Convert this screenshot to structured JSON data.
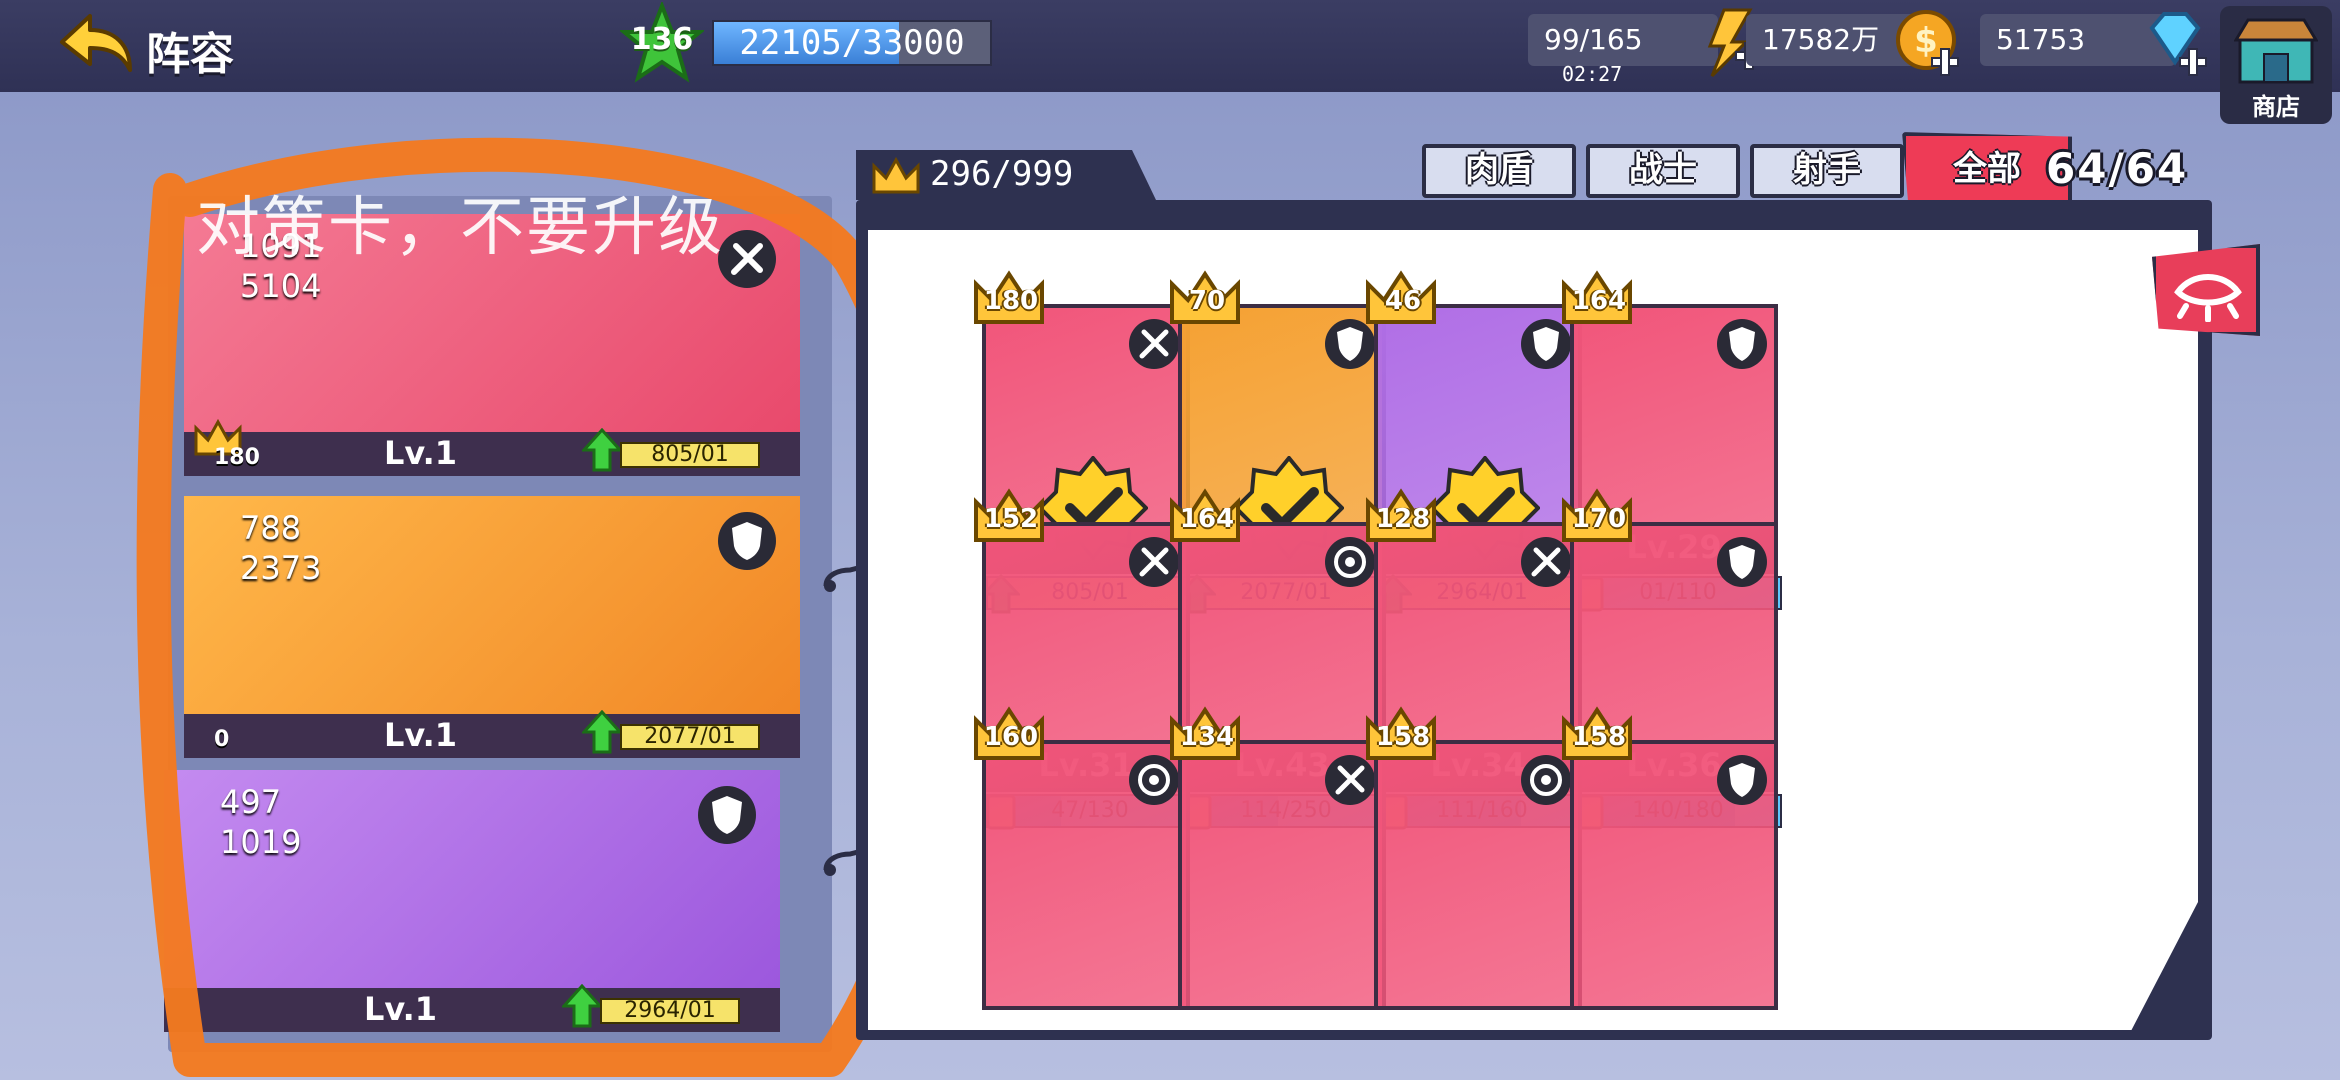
{
  "header": {
    "title": "阵容",
    "player_level": "136",
    "xp_text": "22105/33000",
    "xp_progress": 0.67,
    "stamina": "99/165",
    "stamina_timer": "02:27",
    "gold": "17582万",
    "gems": "51753",
    "shop_label": "商店"
  },
  "note": "对策卡，不要升级",
  "crown_count": "296/999",
  "filters": {
    "tabs": [
      "肉盾",
      "战士",
      "射手",
      "全部"
    ],
    "active": "全部",
    "count": "64/64"
  },
  "teams": [
    {
      "stats": [
        "1091",
        "5104"
      ],
      "crown": "180",
      "level": "Lv.1",
      "progress": "805/01",
      "role_icon": "sword-icon",
      "bg": "#f05a7a"
    },
    {
      "stats": [
        "788",
        "2373"
      ],
      "crown": "0",
      "level": "Lv.1",
      "progress": "2077/01",
      "role_icon": "shield-icon",
      "bg": "#f5a040"
    },
    {
      "stats": [
        "497",
        "1019"
      ],
      "crown": "",
      "level": "Lv.1",
      "progress": "2964/01",
      "role_icon": "shield-icon",
      "bg": "#b473e6"
    }
  ],
  "heroes": [
    {
      "crown": "180",
      "color": "#f1557a",
      "role": "sword-icon",
      "selected": true,
      "level": "",
      "bar": "805/01",
      "bar_type": "upgrade",
      "fill": 1.0
    },
    {
      "crown": "70",
      "color": "#f5a133",
      "role": "shield-icon",
      "selected": true,
      "level": "",
      "bar": "2077/01",
      "bar_type": "upgrade",
      "fill": 1.0
    },
    {
      "crown": "46",
      "color": "#b06ee6",
      "role": "shield-icon",
      "selected": true,
      "level": "",
      "bar": "2964/01",
      "bar_type": "upgrade",
      "fill": 1.0
    },
    {
      "crown": "164",
      "color": "#f1557a",
      "role": "shield-icon",
      "selected": false,
      "level": "Lv.29",
      "bar": "01/110",
      "bar_type": "shards",
      "fill": 0.01
    },
    {
      "crown": "152",
      "color": "#f1557a",
      "role": "sword-icon",
      "selected": false,
      "level": "Lv.31",
      "bar": "47/130",
      "bar_type": "shards",
      "fill": 0.36
    },
    {
      "crown": "164",
      "color": "#f1557a",
      "role": "target-icon",
      "selected": false,
      "level": "Lv.43",
      "bar": "114/250",
      "bar_type": "shards",
      "fill": 0.46
    },
    {
      "crown": "128",
      "color": "#f1557a",
      "role": "sword-icon",
      "selected": false,
      "level": "Lv.34",
      "bar": "111/160",
      "bar_type": "shards",
      "fill": 0.69
    },
    {
      "crown": "170",
      "color": "#f1557a",
      "role": "shield-icon",
      "selected": false,
      "level": "Lv.36",
      "bar": "140/180",
      "bar_type": "shards",
      "fill": 0.78
    },
    {
      "crown": "160",
      "color": "#f1557a",
      "role": "target-icon",
      "selected": false,
      "level": "",
      "bar": "",
      "bar_type": "",
      "fill": 0
    },
    {
      "crown": "134",
      "color": "#f1557a",
      "role": "sword-icon",
      "selected": false,
      "level": "",
      "bar": "",
      "bar_type": "",
      "fill": 0
    },
    {
      "crown": "158",
      "color": "#f1557a",
      "role": "target-icon",
      "selected": false,
      "level": "",
      "bar": "",
      "bar_type": "",
      "fill": 0
    },
    {
      "crown": "158",
      "color": "#f1557a",
      "role": "shield-icon",
      "selected": false,
      "level": "",
      "bar": "",
      "bar_type": "",
      "fill": 0
    }
  ]
}
